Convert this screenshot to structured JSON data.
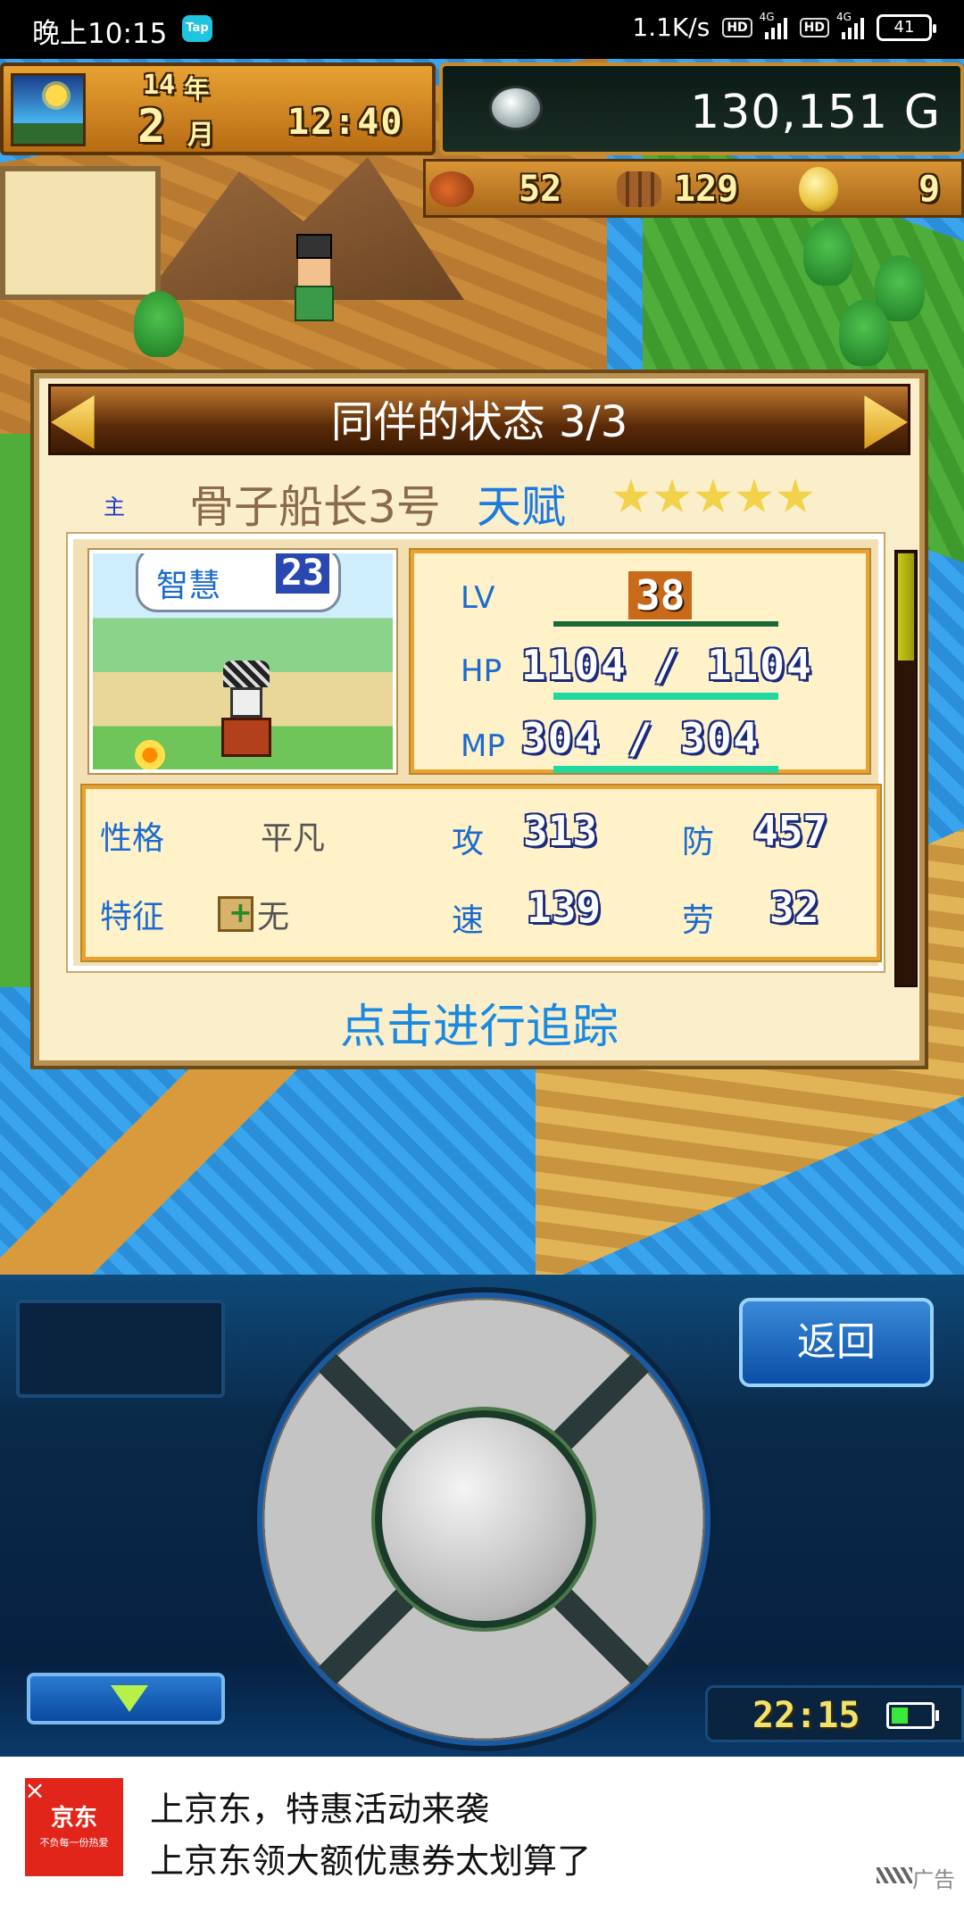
{
  "status_bar": {
    "time": "晚上10:15",
    "tap_badge": "Tap",
    "net_speed": "1.1K/s",
    "hd1": "HD",
    "hd2": "HD",
    "net1": "4G",
    "net2": "4G",
    "battery": "41"
  },
  "hud": {
    "year_num": "14",
    "year_label": "年",
    "month_num": "2",
    "month_label": "月",
    "clock": "12:40",
    "money": "130,151 G",
    "resources": {
      "meat": "52",
      "wood": "129",
      "gem": "9"
    }
  },
  "panel": {
    "title": "同伴的状态 3/3",
    "lead_mark": "主",
    "companion_name": "骨子船长3号",
    "talent_label": "天赋",
    "stars": 5,
    "skill_label": "智慧",
    "skill_value": "23",
    "lv_label": "LV",
    "lv_value": "38",
    "hp_label": "HP",
    "hp_value": "1104 / 1104",
    "hp_fraction": 1.0,
    "mp_label": "MP",
    "mp_value": "304 / 304",
    "mp_fraction": 1.0,
    "personality_label": "性格",
    "personality_value": "平凡",
    "feature_label": "特征",
    "feature_value": "无",
    "atk_label": "攻",
    "atk_value": "313",
    "def_label": "防",
    "def_value": "457",
    "spd_label": "速",
    "spd_value": "139",
    "labor_label": "劳",
    "labor_value": "32",
    "track_button": "点击进行追踪"
  },
  "controls": {
    "back_button": "返回",
    "clock": "22:15"
  },
  "ad": {
    "logo_text": "京东",
    "logo_sub": "不负每一份热爱",
    "title": "上京东，特惠活动来袭",
    "subtitle": "上京东领大额优惠券太划算了",
    "tag": "广告"
  },
  "colors": {
    "accent_blue": "#1a6ad0",
    "panel_bg": "#fbeecb",
    "hp_bar": "#20d8a0",
    "ad_red": "#e1251b"
  }
}
